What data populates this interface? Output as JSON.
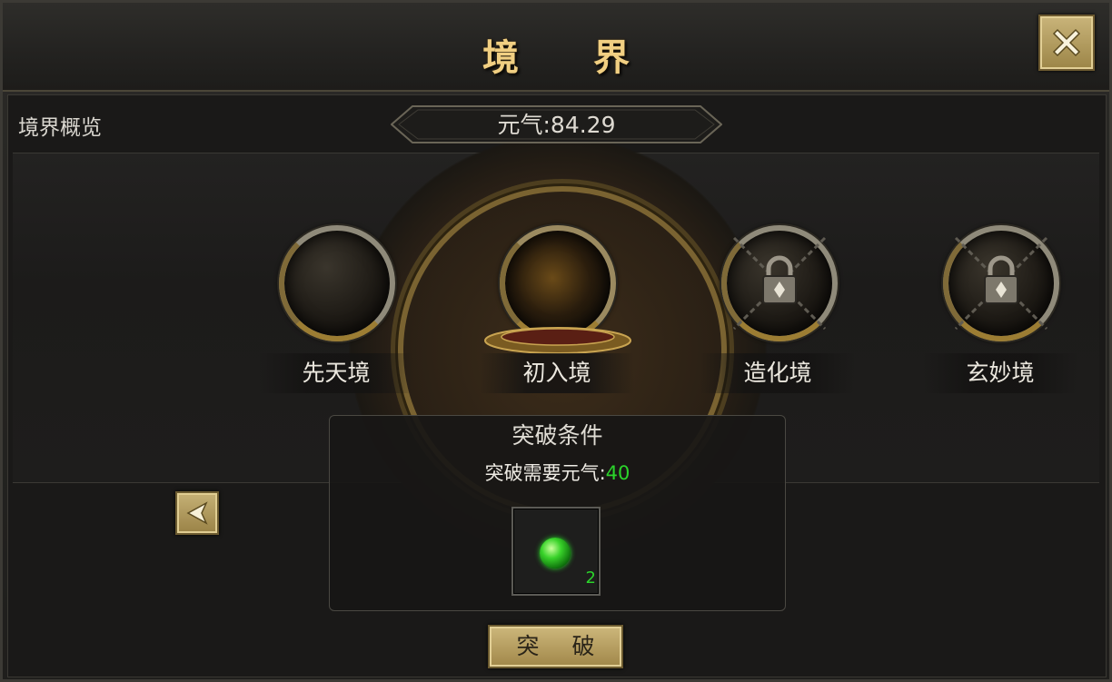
{
  "window": {
    "title": "境 界",
    "close_icon": "close-x-icon"
  },
  "header": {
    "overview_label": "境界概览",
    "qi_label": "元气:84.29"
  },
  "realms": [
    {
      "name": "先天境",
      "state": "unlocked"
    },
    {
      "name": "初入境",
      "state": "current"
    },
    {
      "name": "造化境",
      "state": "locked"
    },
    {
      "name": "玄妙境",
      "state": "locked"
    }
  ],
  "breakthrough": {
    "title": "突破条件",
    "requirement_label": "突破需要元气:",
    "requirement_value": "40",
    "item": {
      "icon": "green-orb-icon",
      "count": "2"
    },
    "button_label": "突 破"
  },
  "nav": {
    "back_icon": "arrow-left-icon"
  },
  "colors": {
    "gold": "#f1cf82",
    "green": "#2bd42b",
    "button": "#b59d5e"
  }
}
